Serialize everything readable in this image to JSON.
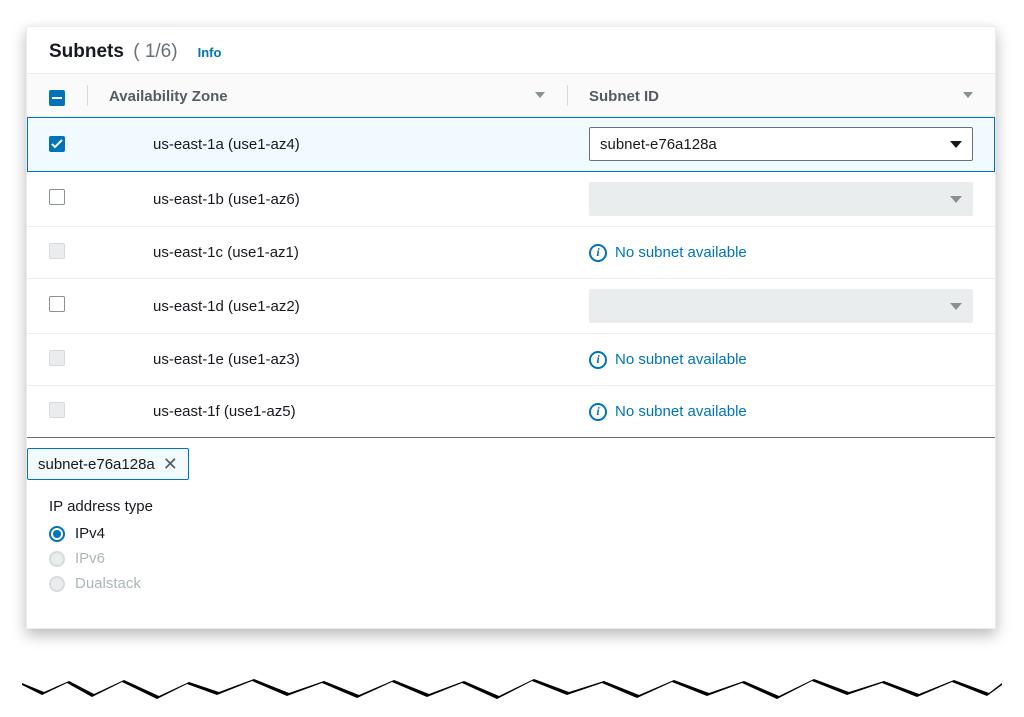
{
  "header": {
    "title": "Subnets",
    "count": "( 1/6)",
    "info": "Info"
  },
  "columns": {
    "az": "Availability Zone",
    "subnet": "Subnet ID"
  },
  "rows": [
    {
      "az": "us-east-1a (use1-az4)",
      "checked": true,
      "state": "select",
      "subnet": "subnet-e76a128a"
    },
    {
      "az": "us-east-1b (use1-az6)",
      "checked": false,
      "state": "disabled-select",
      "subnet": ""
    },
    {
      "az": "us-east-1c (use1-az1)",
      "checked": "disabled",
      "state": "none",
      "subnet": "No subnet available"
    },
    {
      "az": "us-east-1d (use1-az2)",
      "checked": false,
      "state": "disabled-select",
      "subnet": ""
    },
    {
      "az": "us-east-1e (use1-az3)",
      "checked": "disabled",
      "state": "none",
      "subnet": "No subnet available"
    },
    {
      "az": "us-east-1f (use1-az5)",
      "checked": "disabled",
      "state": "none",
      "subnet": "No subnet available"
    }
  ],
  "token": {
    "label": "subnet-e76a128a"
  },
  "ip": {
    "label": "IP address type",
    "options": [
      "IPv4",
      "IPv6",
      "Dualstack"
    ],
    "selected": 0,
    "disabled": [
      1,
      2
    ]
  },
  "no_subnet_text": "No subnet available"
}
